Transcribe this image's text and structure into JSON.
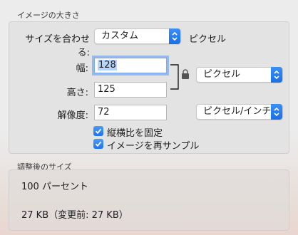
{
  "image_size": {
    "section_title": "イメージの大きさ",
    "fit_label": "サイズを合わせる:",
    "fit_value": "カスタム",
    "fit_unit": "ピクセル",
    "width_label": "幅:",
    "width_value": "128",
    "height_label": "高さ:",
    "height_value": "125",
    "size_unit_value": "ピクセル",
    "resolution_label": "解像度:",
    "resolution_value": "72",
    "resolution_unit_value": "ピクセル/インチ",
    "proportion_label": "縦横比を固定",
    "proportion_checked": true,
    "resample_label": "イメージを再サンプル",
    "resample_checked": true
  },
  "result": {
    "section_title": "調整後のサイズ",
    "percent_text": "100 パーセント",
    "size_text": "27 KB（変更前: 27 KB）"
  },
  "colors": {
    "accent": "#1f73e8",
    "background": "#ececec"
  },
  "icons": {
    "lock": "lock-icon",
    "popup_arrows": "up-down-arrows-icon",
    "checkmark": "checkmark-icon"
  }
}
